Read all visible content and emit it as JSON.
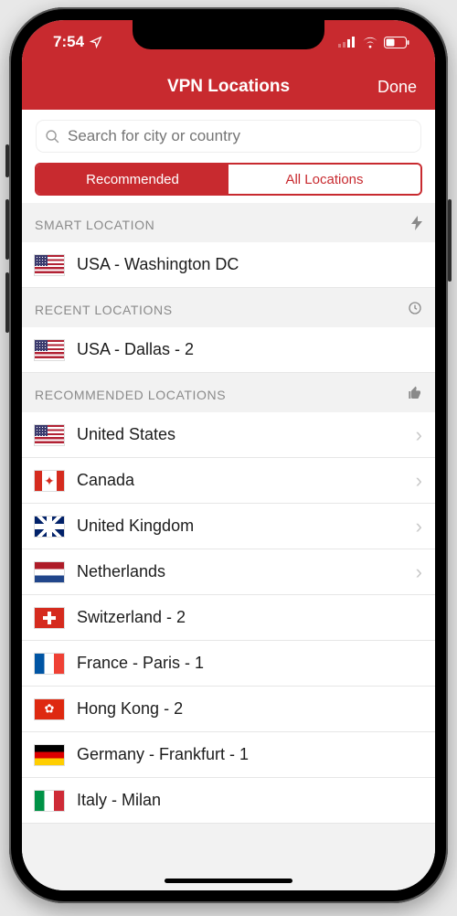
{
  "status": {
    "time": "7:54"
  },
  "nav": {
    "title": "VPN Locations",
    "done": "Done"
  },
  "search": {
    "placeholder": "Search for city or country"
  },
  "tabs": {
    "recommended": "Recommended",
    "all": "All Locations"
  },
  "sections": {
    "smart": {
      "header": "SMART LOCATION",
      "item": {
        "label": "USA - Washington DC",
        "flag": "usa"
      }
    },
    "recent": {
      "header": "RECENT LOCATIONS",
      "item": {
        "label": "USA - Dallas - 2",
        "flag": "usa"
      }
    },
    "recommended": {
      "header": "RECOMMENDED LOCATIONS",
      "items": [
        {
          "label": "United States",
          "flag": "usa",
          "chevron": true
        },
        {
          "label": "Canada",
          "flag": "canada",
          "chevron": true
        },
        {
          "label": "United Kingdom",
          "flag": "uk",
          "chevron": true
        },
        {
          "label": "Netherlands",
          "flag": "nl",
          "chevron": true
        },
        {
          "label": "Switzerland - 2",
          "flag": "ch",
          "chevron": false
        },
        {
          "label": "France - Paris - 1",
          "flag": "fr",
          "chevron": false
        },
        {
          "label": "Hong Kong - 2",
          "flag": "hk",
          "chevron": false
        },
        {
          "label": "Germany - Frankfurt - 1",
          "flag": "de",
          "chevron": false
        },
        {
          "label": "Italy - Milan",
          "flag": "it",
          "chevron": false
        }
      ]
    }
  },
  "colors": {
    "accent": "#c82a2f"
  }
}
